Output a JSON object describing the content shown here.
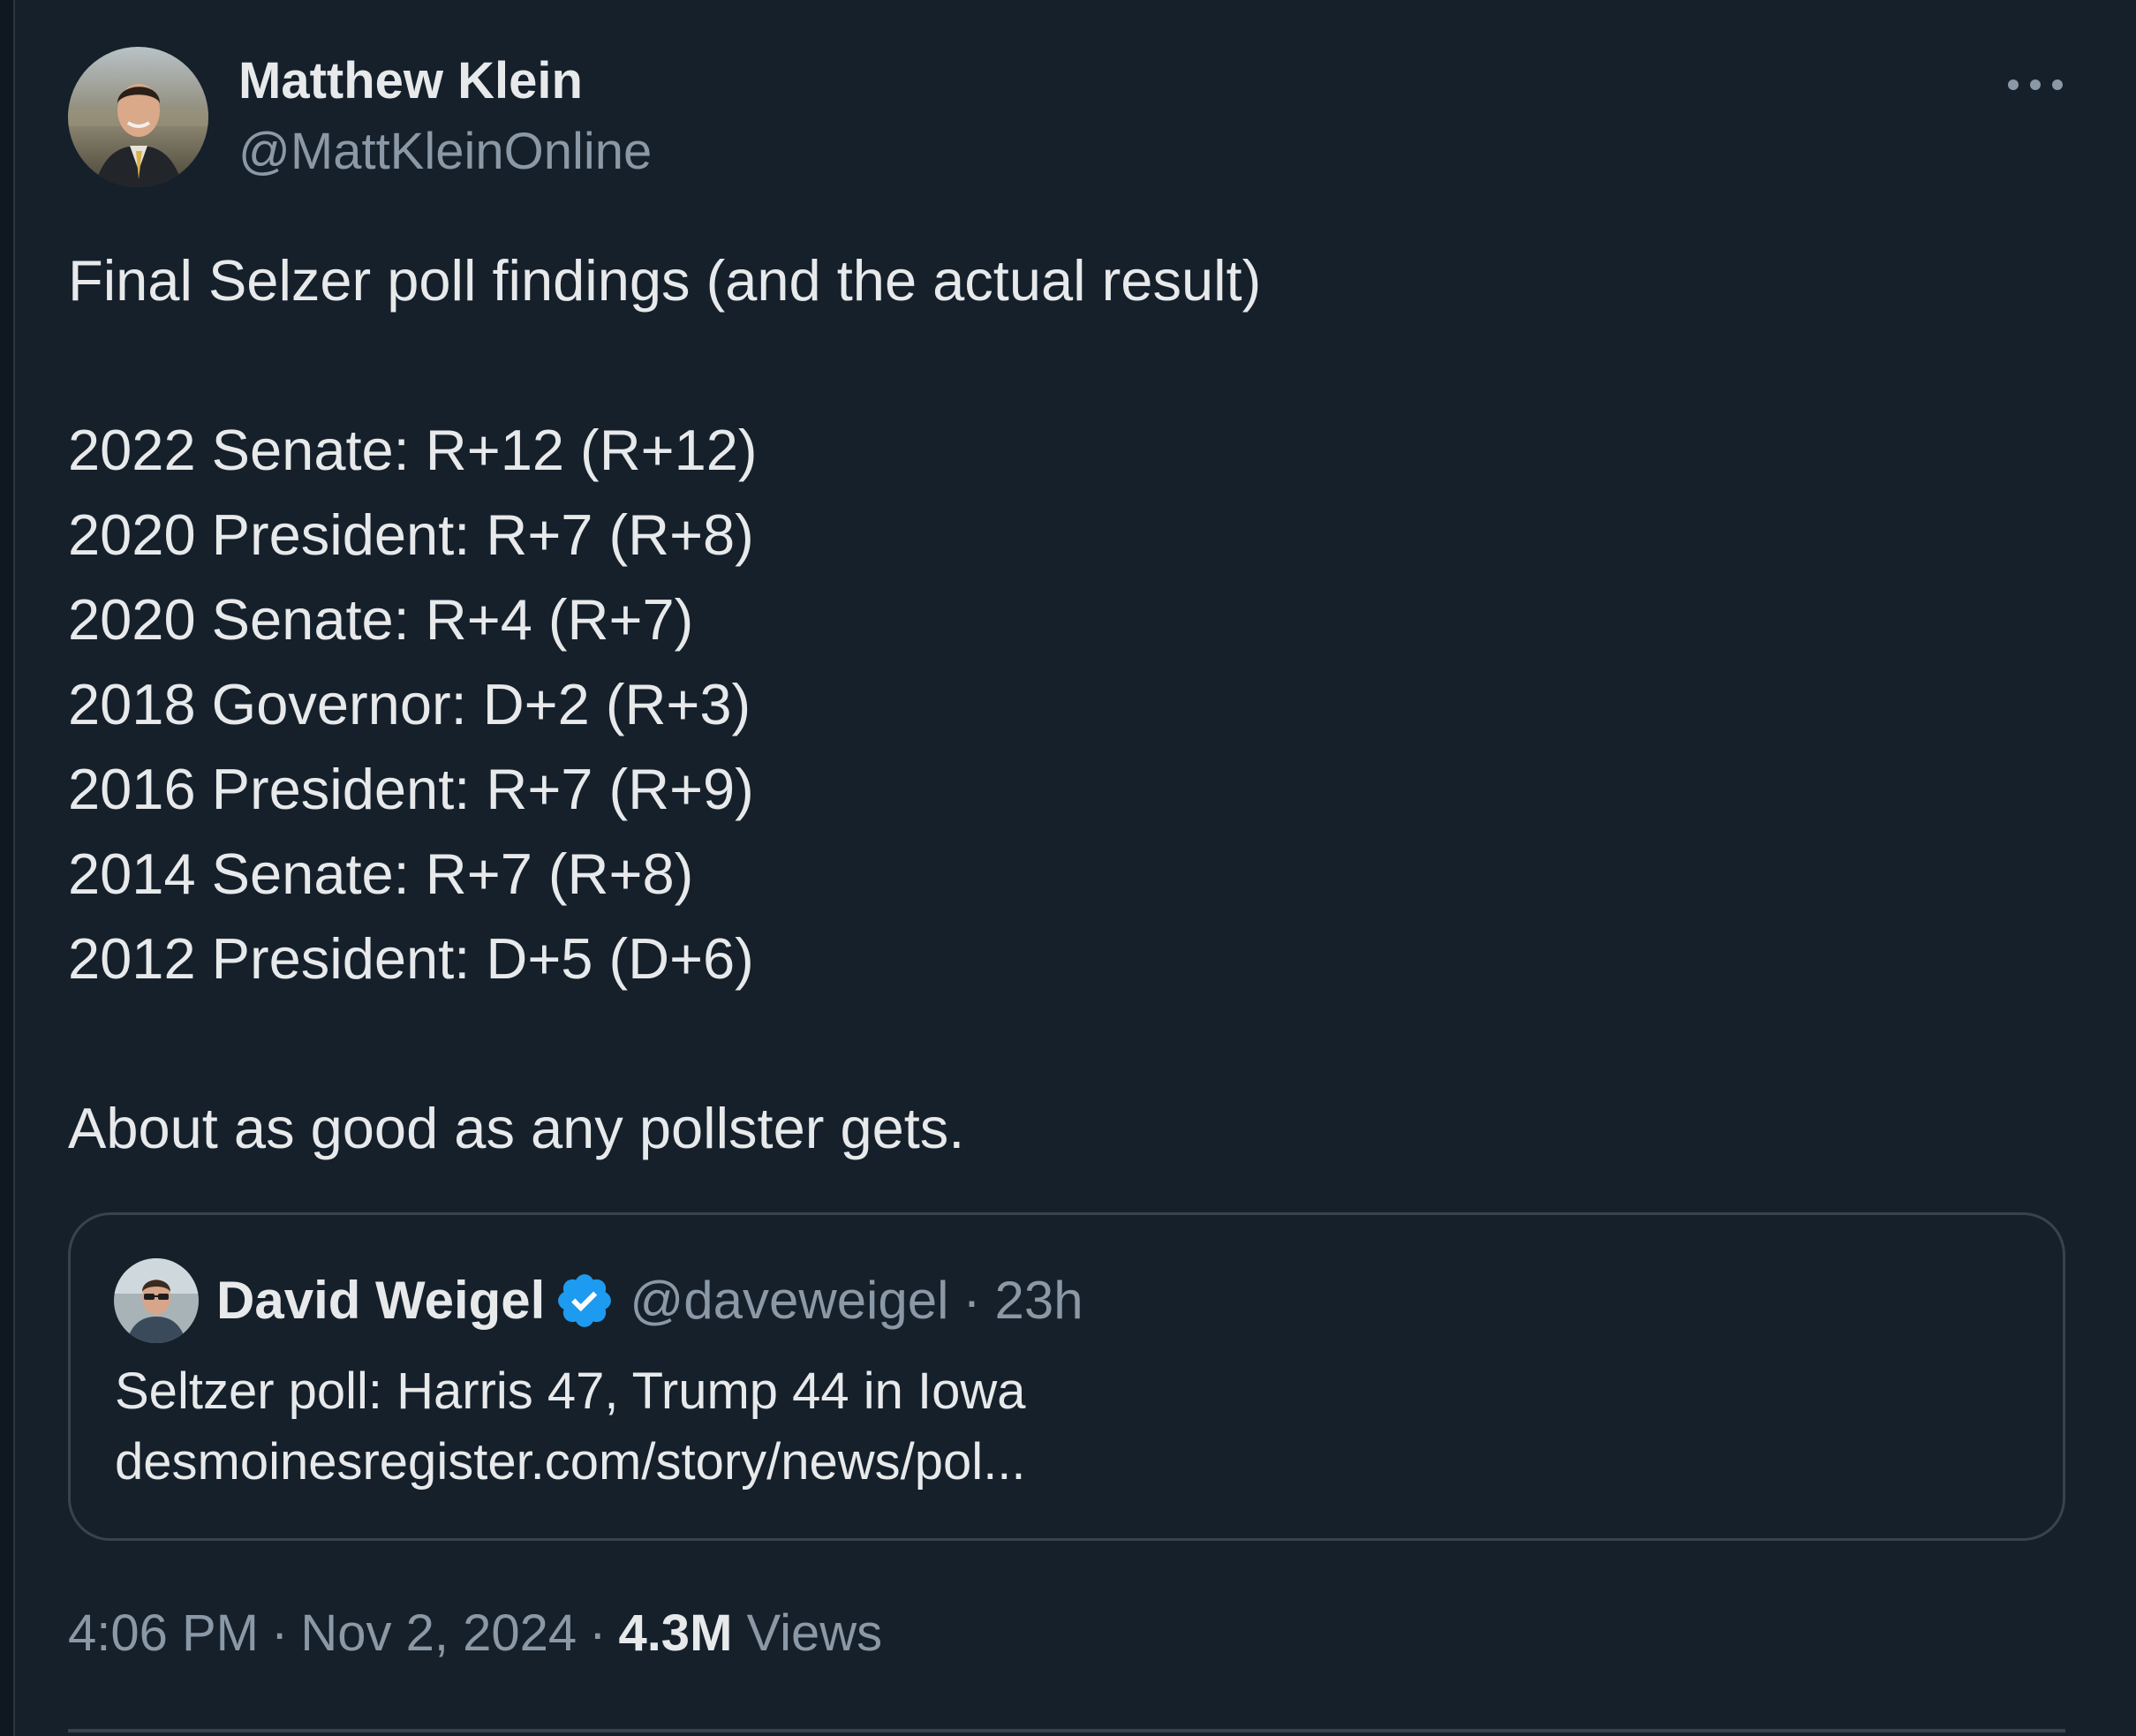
{
  "author": {
    "name": "Matthew Klein",
    "handle": "@MattKleinOnline"
  },
  "tweet": {
    "intro": "Final Selzer poll findings (and the actual result)",
    "results": [
      "2022 Senate: R+12 (R+12)",
      "2020 President: R+7 (R+8)",
      "2020 Senate: R+4 (R+7)",
      "2018 Governor: D+2 (R+3)",
      "2016 President: R+7 (R+9)",
      "2014 Senate: R+7 (R+8)",
      "2012 President: D+5 (D+6)"
    ],
    "closing": "About as good as any pollster gets."
  },
  "quote": {
    "name": "David Weigel",
    "handle": "@daveweigel",
    "separator": "·",
    "time": "23h",
    "text_line1": "Seltzer poll: Harris 47, Trump 44 in Iowa",
    "text_line2": "desmoinesregister.com/story/news/pol..."
  },
  "meta": {
    "time": "4:06 PM",
    "separator": "·",
    "date": "Nov 2, 2024",
    "views_count": "4.3M",
    "views_label": "Views"
  },
  "colors": {
    "background": "#15202b",
    "text": "#e7e9ea",
    "secondary": "#8b98a5",
    "border": "#38444d",
    "verified": "#1d9bf0"
  },
  "icons": {
    "more": "more-horizontal-icon",
    "verified": "verified-badge-icon"
  }
}
